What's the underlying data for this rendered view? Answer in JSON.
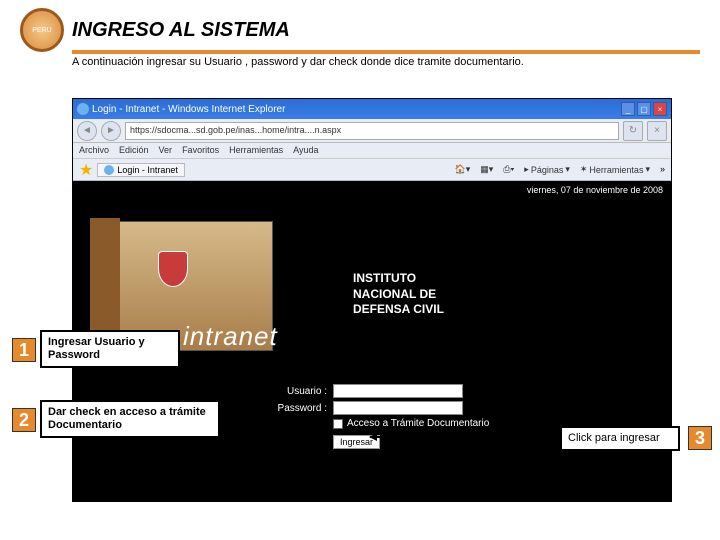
{
  "header": {
    "title": "INGRESO AL SISTEMA"
  },
  "subtitle": "A continuación ingresar su Usuario , password y dar check donde dice tramite documentario.",
  "browser": {
    "window_title": "Login - Intranet - Windows Internet Explorer",
    "url": "https://sdocma...sd.gob.pe/inas...home/intra....n.aspx",
    "menus": [
      "Archivo",
      "Edición",
      "Ver",
      "Favoritos",
      "Herramientas",
      "Ayuda"
    ],
    "tab_label": "Login - Intranet",
    "tool_paginas": "Páginas",
    "tool_herramientas": "Herramientas"
  },
  "page": {
    "date": "viernes, 07 de noviembre de 2008",
    "org_line1": "INSTITUTO",
    "org_line2": "NACIONAL DE",
    "org_line3": "DEFENSA CIVIL",
    "intranet": "intranet",
    "form": {
      "usuario_label": "Usuario :",
      "password_label": "Password :",
      "checkbox_label": "Acceso a Trámite Documentario",
      "submit": "Ingresar"
    }
  },
  "steps": {
    "s1": {
      "num": "1",
      "text": "Ingresar Usuario y Password"
    },
    "s2": {
      "num": "2",
      "text": "Dar check en acceso a trámite Documentario"
    },
    "s3": {
      "num": "3",
      "text": "Click para ingresar"
    }
  }
}
